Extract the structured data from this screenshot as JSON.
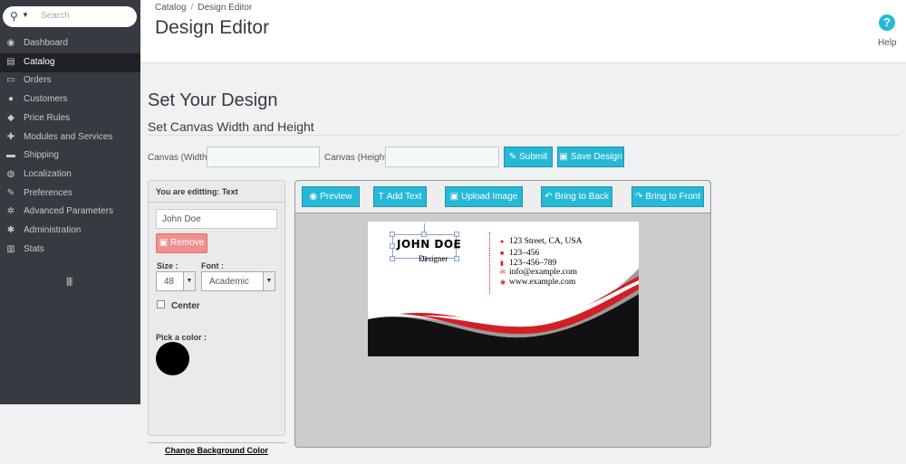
{
  "sidebar": {
    "search_placeholder": "Search",
    "items": [
      {
        "label": "Dashboard",
        "icon": "dashboard-icon",
        "glyph": "◉"
      },
      {
        "label": "Catalog",
        "icon": "book-icon",
        "glyph": "▤"
      },
      {
        "label": "Orders",
        "icon": "credit-card-icon",
        "glyph": "▭"
      },
      {
        "label": "Customers",
        "icon": "user-icon",
        "glyph": "●"
      },
      {
        "label": "Price Rules",
        "icon": "tag-icon",
        "glyph": "◆"
      },
      {
        "label": "Modules and Services",
        "icon": "puzzle-icon",
        "glyph": "✚"
      },
      {
        "label": "Shipping",
        "icon": "truck-icon",
        "glyph": "▬"
      },
      {
        "label": "Localization",
        "icon": "globe-icon",
        "glyph": "◍"
      },
      {
        "label": "Preferences",
        "icon": "wrench-icon",
        "glyph": "✎"
      },
      {
        "label": "Advanced Parameters",
        "icon": "cogs-icon",
        "glyph": "✲"
      },
      {
        "label": "Administration",
        "icon": "gear-icon",
        "glyph": "✱"
      },
      {
        "label": "Stats",
        "icon": "bar-chart-icon",
        "glyph": "▥"
      }
    ],
    "active_index": 1
  },
  "header": {
    "breadcrumb": [
      "Catalog",
      "Design Editor"
    ],
    "breadcrumb_sep": "/",
    "title": "Design Editor",
    "help_label": "Help"
  },
  "main": {
    "title": "Set Your Design",
    "subtitle": "Set Canvas Width and Height",
    "canvas_width_label": "Canvas (Width):",
    "canvas_width_value": "",
    "canvas_height_label": "Canvas (Height):",
    "canvas_height_value": "",
    "submit_label": "Submit",
    "save_label": "Save Design"
  },
  "edit_panel": {
    "heading": "You are editting: Text",
    "text_value": "John Doe",
    "remove_label": "Remove",
    "size_label": "Size :",
    "size_value": "48",
    "font_label": "Font :",
    "font_value": "Academic",
    "center_label": "Center",
    "center_checked": false,
    "pick_color_label": "Pick a color :",
    "color": "#000000",
    "change_bg_label": "Change Background Color"
  },
  "toolbar": {
    "preview": "Preview",
    "add_text": "Add Text",
    "upload_image": "Upload Image",
    "bring_back": "Bring to Back",
    "bring_front": "Bring to Front"
  },
  "card": {
    "name": "JOHN DOE",
    "role": "Designer",
    "address": "123 Street, CA, USA",
    "phone1": "123–456",
    "phone2": "123–456–789",
    "email": "info@example.com",
    "web": "www.example.com",
    "accent": "#d21f25"
  },
  "colors": {
    "sidebar_bg": "#363a41",
    "primary": "#25b9d7",
    "danger": "#f08f8f"
  }
}
